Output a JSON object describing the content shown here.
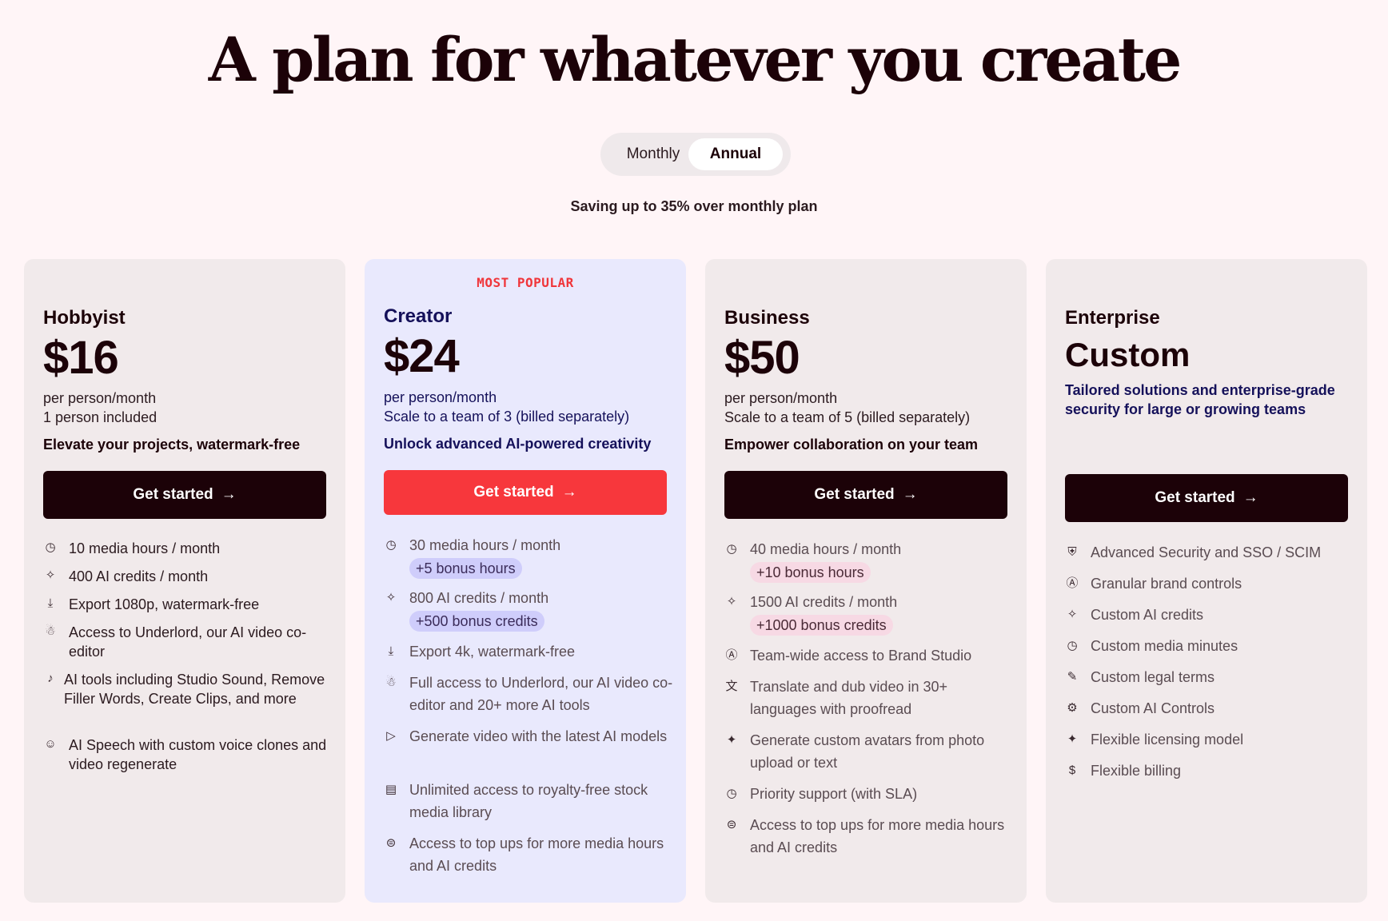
{
  "headline": "A plan for whatever you create",
  "billing_toggle": {
    "monthly": "Monthly",
    "annual": "Annual",
    "selected": "Annual"
  },
  "saving_note": "Saving up to 35% over monthly plan",
  "icons": {
    "clock": "◷",
    "sparkle": "✧",
    "download": "⤓",
    "robot": "☃",
    "mic": "♪",
    "voice": "☺",
    "video": "▷",
    "media": "▤",
    "topup": "⊜",
    "brand": "Ⓐ",
    "translate": "文",
    "avatar": "✦",
    "shield": "⛨",
    "pen": "✎",
    "gear": "⚙",
    "dollar": "$"
  },
  "plans": [
    {
      "name": "Hobbyist",
      "price": "$16",
      "sub1": "per person/month",
      "sub2": "1 person included",
      "tagline": "Elevate your projects, watermark-free",
      "cta": "Get started",
      "features": [
        {
          "icon": "clock-icon",
          "text": "10 media hours / month"
        },
        {
          "icon": "sparkle-icon",
          "text": "400 AI credits / month"
        },
        {
          "icon": "download-icon",
          "text": "Export 1080p, watermark-free"
        },
        {
          "icon": "robot-icon",
          "text": "Access to Underlord, our AI video co-editor"
        },
        {
          "icon": "mic-icon",
          "text": "AI tools including Studio Sound, Remove Filler Words, Create Clips, and more"
        },
        {
          "icon": "voice-icon",
          "text": "AI Speech with custom voice clones and video regenerate"
        }
      ]
    },
    {
      "badge": "MOST POPULAR",
      "name": "Creator",
      "price": "$24",
      "sub1": "per person/month",
      "sub2": "Scale to a team of 3 (billed separately)",
      "tagline": "Unlock advanced AI-powered creativity",
      "cta": "Get started",
      "features": [
        {
          "icon": "clock-icon",
          "text": "30 media hours / month",
          "bonus": "+5 bonus hours"
        },
        {
          "icon": "sparkle-icon",
          "text": "800 AI credits / month",
          "bonus": "+500 bonus credits"
        },
        {
          "icon": "download-icon",
          "text": "Export 4k, watermark-free"
        },
        {
          "icon": "robot-icon",
          "text": "Full access to Underlord, our AI video co-editor and 20+ more AI tools"
        },
        {
          "icon": "video-icon",
          "text": "Generate video with the latest AI models"
        },
        {
          "icon": "media-icon",
          "text": "Unlimited access to royalty-free stock media library"
        },
        {
          "icon": "topup-icon",
          "text": "Access to top ups for more media hours and AI credits"
        }
      ]
    },
    {
      "name": "Business",
      "price": "$50",
      "sub1": "per person/month",
      "sub2": "Scale to a team of 5 (billed separately)",
      "tagline": "Empower collaboration on your team",
      "cta": "Get started",
      "features": [
        {
          "icon": "clock-icon",
          "text": "40 media hours / month",
          "bonus": "+10 bonus hours"
        },
        {
          "icon": "sparkle-icon",
          "text": "1500 AI credits / month",
          "bonus": "+1000 bonus credits"
        },
        {
          "icon": "brand-icon",
          "text": "Team-wide access to Brand Studio"
        },
        {
          "icon": "translate-icon",
          "text": "Translate and dub video in 30+ languages with proofread"
        },
        {
          "icon": "avatar-icon",
          "text": "Generate custom avatars from photo upload or text"
        },
        {
          "icon": "clock-icon",
          "text": "Priority support (with SLA)"
        },
        {
          "icon": "topup-icon",
          "text": "Access to top ups for more media hours and AI credits"
        }
      ]
    },
    {
      "name": "Enterprise",
      "price": "Custom",
      "description": "Tailored solutions and enterprise-grade security for large or growing teams",
      "cta": "Get started",
      "features": [
        {
          "icon": "shield-icon",
          "text": "Advanced Security and SSO / SCIM"
        },
        {
          "icon": "brand-icon",
          "text": "Granular brand controls"
        },
        {
          "icon": "sparkle-icon",
          "text": "Custom AI credits"
        },
        {
          "icon": "clock-icon",
          "text": "Custom media minutes"
        },
        {
          "icon": "pen-icon",
          "text": "Custom legal terms"
        },
        {
          "icon": "gear-icon",
          "text": "Custom AI Controls"
        },
        {
          "icon": "avatar-icon",
          "text": "Flexible licensing model"
        },
        {
          "icon": "dollar-icon",
          "text": "Flexible billing"
        }
      ]
    }
  ]
}
